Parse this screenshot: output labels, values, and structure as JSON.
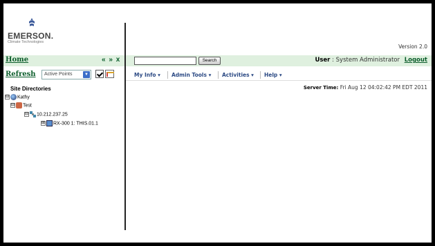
{
  "branding": {
    "company": "EMERSON.",
    "subtitle": "Climate Technologies",
    "version": "Version 2.0"
  },
  "left": {
    "home": "Home",
    "nav": [
      "«",
      "»",
      "x"
    ],
    "refresh": "Refresh",
    "points_select": "Active Points",
    "tree_title": "Site Directories",
    "tree": [
      {
        "label": "Kathy",
        "toggle": "⊟",
        "icon": "globe-icon"
      },
      {
        "label": "Test",
        "toggle": "⊟",
        "icon": "site-icon"
      },
      {
        "label": "10.212.237.25",
        "toggle": "⊟",
        "icon": "network-icon"
      },
      {
        "label": "RX-300 1: THIS.01.1",
        "toggle": "⊞",
        "icon": "device-icon"
      }
    ]
  },
  "header": {
    "search_button": "Search",
    "user_label": "User",
    "user_separator": ":",
    "user_name": "System Administrator",
    "logout": "Logout"
  },
  "menu": [
    "My Info ▾",
    "Admin Tools ▾",
    "Activities ▾",
    "Help ▾"
  ],
  "server": {
    "label": "Server Time:",
    "time": "Fri Aug 12 04:02:42 PM EDT 2011"
  }
}
